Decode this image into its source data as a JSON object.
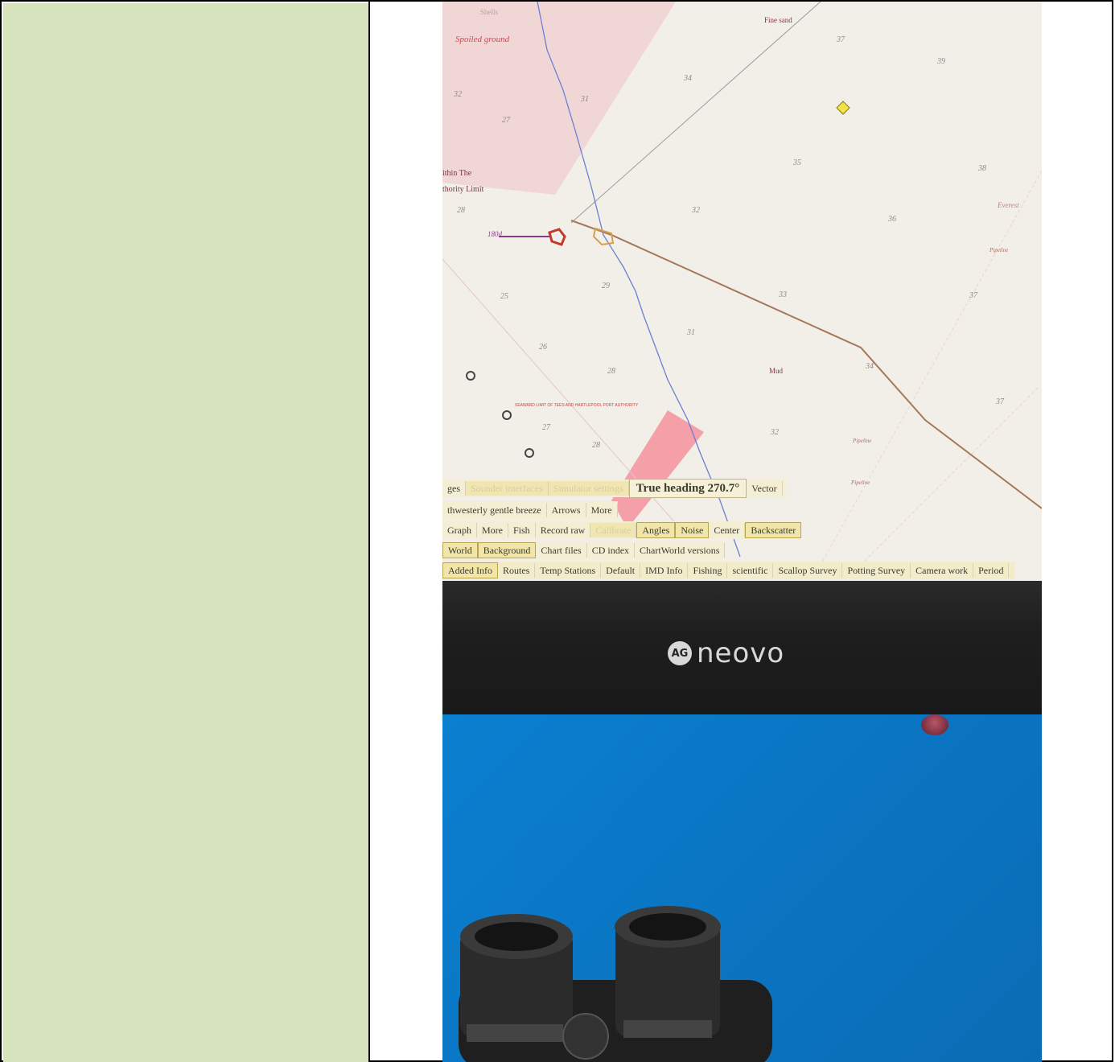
{
  "chart": {
    "labels": {
      "spoiled_ground": "Spoiled ground",
      "within_the": "ithin The",
      "authority_limit": "thority Limit",
      "fine_sand": "Fine sand",
      "mud": "Mud",
      "everest": "Everest",
      "pipeline": "Pipeline",
      "seaward_limit": "SEAWARD LIMIT OF TEES AND HARTLEPOOL PORT AUTHORITY",
      "vessel_id": "180d",
      "shells": "Shells"
    },
    "depths": [
      "37",
      "39",
      "34",
      "31",
      "27",
      "32",
      "35",
      "38",
      "36",
      "33",
      "37",
      "32",
      "28",
      "26",
      "29",
      "31",
      "28",
      "25",
      "34",
      "32",
      "27",
      "28",
      "37"
    ]
  },
  "toolbar": {
    "row1": {
      "items": [
        "ges"
      ],
      "dim_items": [
        "Sounder interfaces",
        "Simulator settings"
      ],
      "heading": "True heading 270.7°",
      "vector": "Vector"
    },
    "row2": {
      "items": [
        "thwesterly gentle breeze",
        "Arrows",
        "More"
      ]
    },
    "row3": {
      "items": [
        "Graph",
        "More",
        "Fish",
        "Record raw"
      ],
      "dim_item": "Calibrate",
      "sel_items": [
        "Angles",
        "Noise"
      ],
      "center": "Center",
      "backscatter": "Backscatter"
    },
    "row4": {
      "world": "World",
      "background": "Background",
      "items": [
        "Chart files",
        "CD index",
        "ChartWorld versions"
      ]
    },
    "row5": {
      "added_info": "Added Info",
      "items": [
        "Routes",
        "Temp Stations",
        "Default",
        "IMD Info",
        "Fishing",
        "scientific",
        "Scallop Survey",
        "Potting Survey",
        "Camera work",
        "Period"
      ]
    }
  },
  "monitor": {
    "brand_logo": "AG",
    "brand_name": "neovo"
  },
  "colors": {
    "left_cell": "#d6e3bd",
    "wall": "#0a79c9",
    "chart_bg": "#f2efe8",
    "track": "#a5785a",
    "vessel": "#c0392b"
  }
}
